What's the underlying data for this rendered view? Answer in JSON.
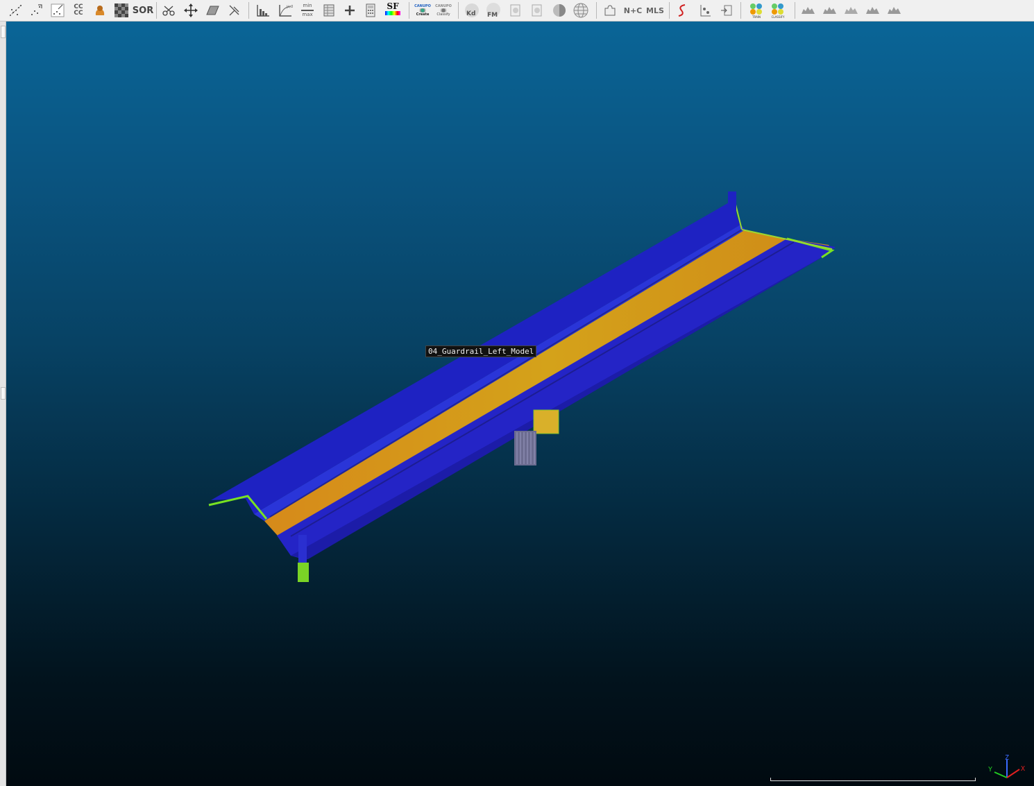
{
  "toolbar": {
    "groups": [
      [
        "sample-points",
        "subsample",
        "normals",
        "cc-label",
        "noise-filter",
        "checker",
        "sor"
      ],
      [
        "scissors",
        "translate-rotate",
        "plane-fit",
        "cross-section"
      ],
      [
        "histogram",
        "sf-curve",
        "min-max",
        "sf-table",
        "add-sf",
        "calculator",
        "sf-label"
      ],
      [
        "canupo-create",
        "canupo-classify"
      ],
      [
        "kd-tree",
        "fm",
        "scalar-export-a",
        "scalar-export-b",
        "sphere-shaded",
        "globe"
      ],
      [
        "puzzle",
        "normals-curvature",
        "mls"
      ],
      [
        "s-curve",
        "point-pair",
        "segment-tool"
      ],
      [
        "3dmasc-train",
        "3dmasc-classify"
      ],
      [
        "hand-a",
        "hand-b",
        "hand-c",
        "hand-d",
        "hand-e"
      ]
    ],
    "cc_label": "CC\nCC",
    "sor_label": "SOR",
    "sf_label": "SF",
    "canupo_title": "CANUPO",
    "canupo_create": "Create",
    "canupo_classify": "Classify",
    "kd_label": "Kd",
    "fm_label": "FM",
    "nc_label": "N+C",
    "mls_label": "MLS",
    "masc_train": "TRAIN",
    "masc_classify": "CLASSIFY",
    "minmax_top": "min",
    "minmax_bottom": "max"
  },
  "viewport": {
    "object_label": "04_Guardrail_Left_Model",
    "axis": {
      "x": "X",
      "y": "Y",
      "z": "Z"
    },
    "colors": {
      "bg_top": "#0a6597",
      "bg_bottom": "#010a10",
      "deck": "#d79a18",
      "rail": "#1f22c8",
      "edge": "#6ce21e"
    }
  }
}
